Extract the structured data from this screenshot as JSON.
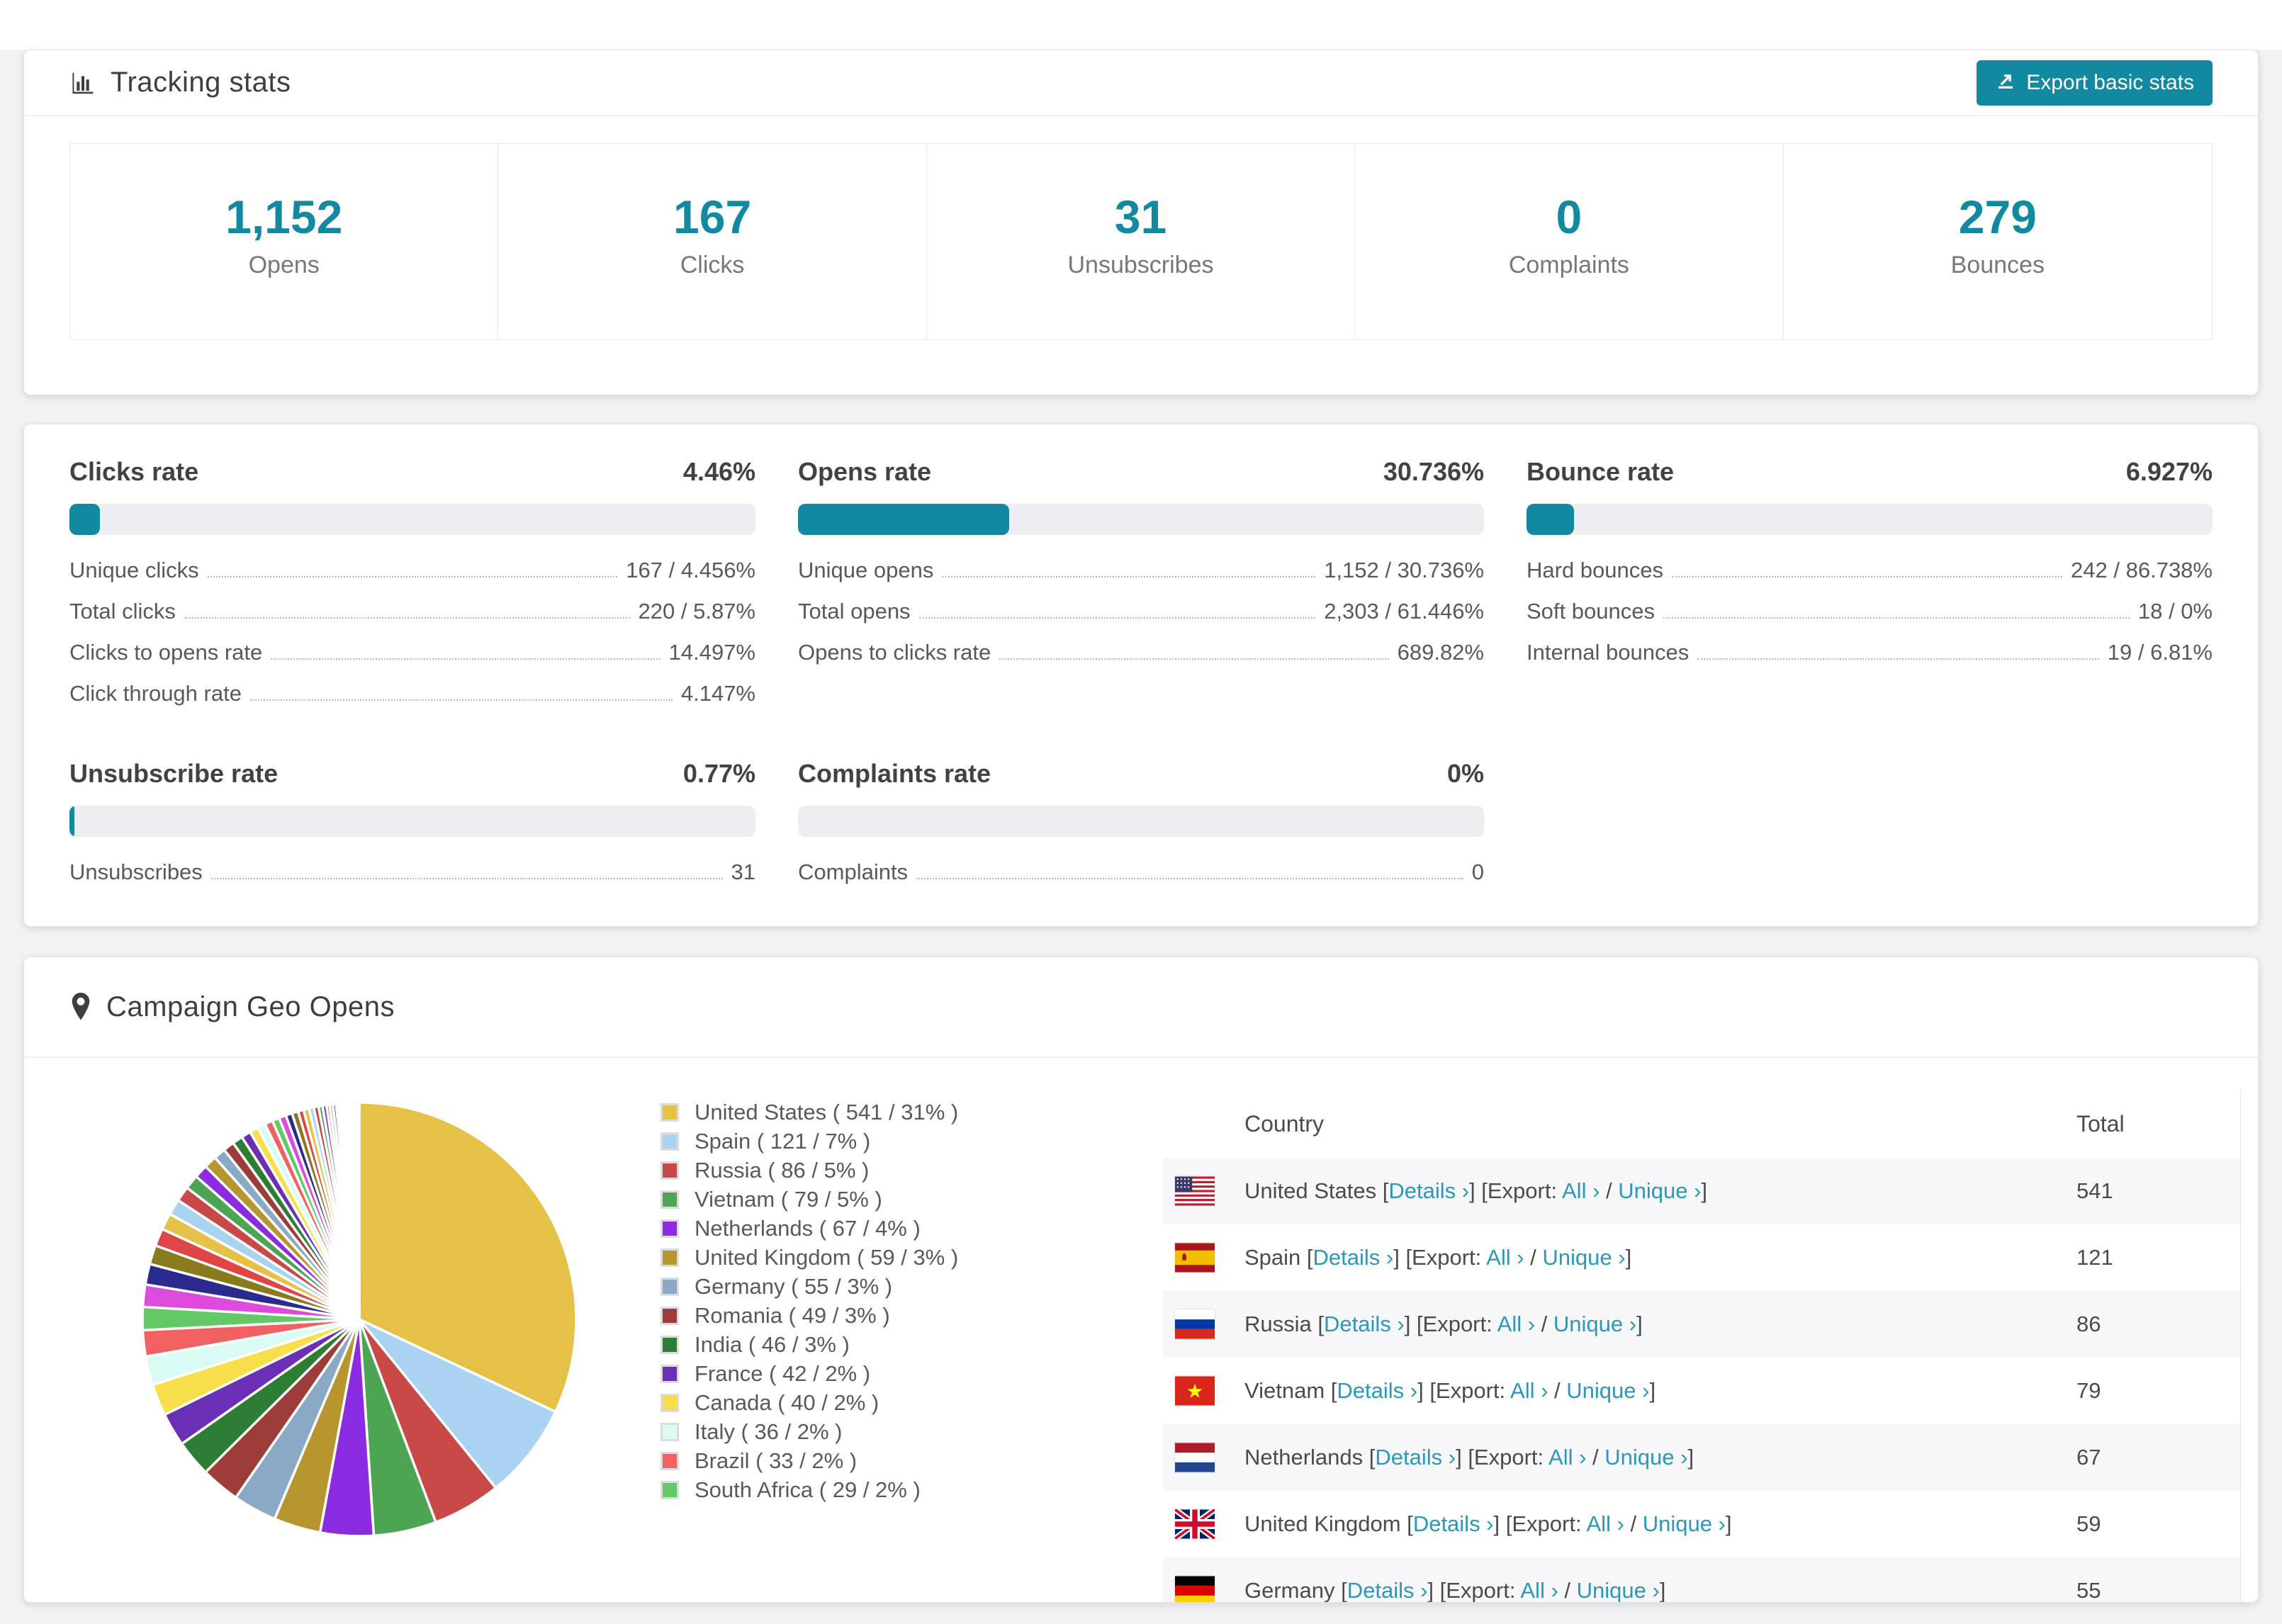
{
  "colors": {
    "accent": "#1289a0",
    "link": "#2b97ba",
    "page_bg": "#f2f2f4",
    "bar_track": "#eceef1",
    "row_stripe": "#f7f7f9"
  },
  "tracking": {
    "title": "Tracking stats",
    "export_label": "Export basic stats",
    "stats": [
      {
        "value": "1,152",
        "label": "Opens"
      },
      {
        "value": "167",
        "label": "Clicks"
      },
      {
        "value": "31",
        "label": "Unsubscribes"
      },
      {
        "value": "0",
        "label": "Complaints"
      },
      {
        "value": "279",
        "label": "Bounces"
      }
    ]
  },
  "rates": {
    "blocks": [
      {
        "title": "Clicks rate",
        "value": "4.46%",
        "percent": 4.46,
        "rows": [
          [
            "Unique clicks",
            "167 / 4.456%"
          ],
          [
            "Total clicks",
            "220 / 5.87%"
          ],
          [
            "Clicks to opens rate",
            "14.497%"
          ],
          [
            "Click through rate",
            "4.147%"
          ]
        ]
      },
      {
        "title": "Opens rate",
        "value": "30.736%",
        "percent": 30.736,
        "rows": [
          [
            "Unique opens",
            "1,152 / 30.736%"
          ],
          [
            "Total opens",
            "2,303 / 61.446%"
          ],
          [
            "Opens to clicks rate",
            "689.82%"
          ]
        ]
      },
      {
        "title": "Bounce rate",
        "value": "6.927%",
        "percent": 6.927,
        "rows": [
          [
            "Hard bounces",
            "242 / 86.738%"
          ],
          [
            "Soft bounces",
            "18 / 0%"
          ],
          [
            "Internal bounces",
            "19 / 6.81%"
          ]
        ]
      },
      {
        "title": "Unsubscribe rate",
        "value": "0.77%",
        "percent": 0.77,
        "rows": [
          [
            "Unsubscribes",
            "31"
          ]
        ]
      },
      {
        "title": "Complaints rate",
        "value": "0%",
        "percent": 0,
        "rows": [
          [
            "Complaints",
            "0"
          ]
        ]
      }
    ]
  },
  "geo": {
    "title": "Campaign Geo Opens",
    "table": {
      "columns": [
        "Country",
        "Total"
      ],
      "link_labels": {
        "details": "Details",
        "export": "Export:",
        "all": "All",
        "unique": "Unique",
        "chevron": "›"
      },
      "rows": [
        {
          "flag": "us",
          "name": "United States",
          "total": "541"
        },
        {
          "flag": "es",
          "name": "Spain",
          "total": "121"
        },
        {
          "flag": "ru",
          "name": "Russia",
          "total": "86"
        },
        {
          "flag": "vn",
          "name": "Vietnam",
          "total": "79"
        },
        {
          "flag": "nl",
          "name": "Netherlands",
          "total": "67"
        },
        {
          "flag": "gb",
          "name": "United Kingdom",
          "total": "59"
        },
        {
          "flag": "de",
          "name": "Germany",
          "total": "55"
        }
      ]
    }
  },
  "chart_data": {
    "type": "pie",
    "title": "Campaign Geo Opens",
    "legend_position": "right",
    "start_angle_deg": -90,
    "direction": "clockwise",
    "entries": [
      {
        "name": "United States",
        "value": 541,
        "pct": 31
      },
      {
        "name": "Spain",
        "value": 121,
        "pct": 7
      },
      {
        "name": "Russia",
        "value": 86,
        "pct": 5
      },
      {
        "name": "Vietnam",
        "value": 79,
        "pct": 5
      },
      {
        "name": "Netherlands",
        "value": 67,
        "pct": 4
      },
      {
        "name": "United Kingdom",
        "value": 59,
        "pct": 3
      },
      {
        "name": "Germany",
        "value": 55,
        "pct": 3
      },
      {
        "name": "Romania",
        "value": 49,
        "pct": 3
      },
      {
        "name": "India",
        "value": 46,
        "pct": 3
      },
      {
        "name": "France",
        "value": 42,
        "pct": 2
      },
      {
        "name": "Canada",
        "value": 40,
        "pct": 2
      },
      {
        "name": "Italy",
        "value": 36,
        "pct": 2
      },
      {
        "name": "Brazil",
        "value": 33,
        "pct": 2
      },
      {
        "name": "South Africa",
        "value": 29,
        "pct": 2
      }
    ],
    "others_values": [
      28,
      26,
      24,
      22,
      21,
      20,
      19,
      18,
      17,
      16,
      15,
      14,
      13,
      12,
      11,
      10,
      10,
      9,
      9,
      8,
      8,
      7,
      7,
      6,
      6,
      5,
      5,
      4,
      4,
      4,
      3,
      3,
      3,
      2,
      2,
      2,
      2,
      2,
      1,
      1,
      1,
      1,
      1,
      1,
      1,
      1,
      1,
      1
    ],
    "palette": [
      "#E5C148",
      "#A9D3F1",
      "#C94949",
      "#4BA553",
      "#8B2BE2",
      "#B7952F",
      "#8AA9C5",
      "#9D3C38",
      "#2E7D34",
      "#6A2FB5",
      "#F7DF4B",
      "#D9FBF4",
      "#F26161",
      "#62C966",
      "#DD4BDD",
      "#2B2B8F",
      "#8A7A1E",
      "#E04545"
    ]
  }
}
